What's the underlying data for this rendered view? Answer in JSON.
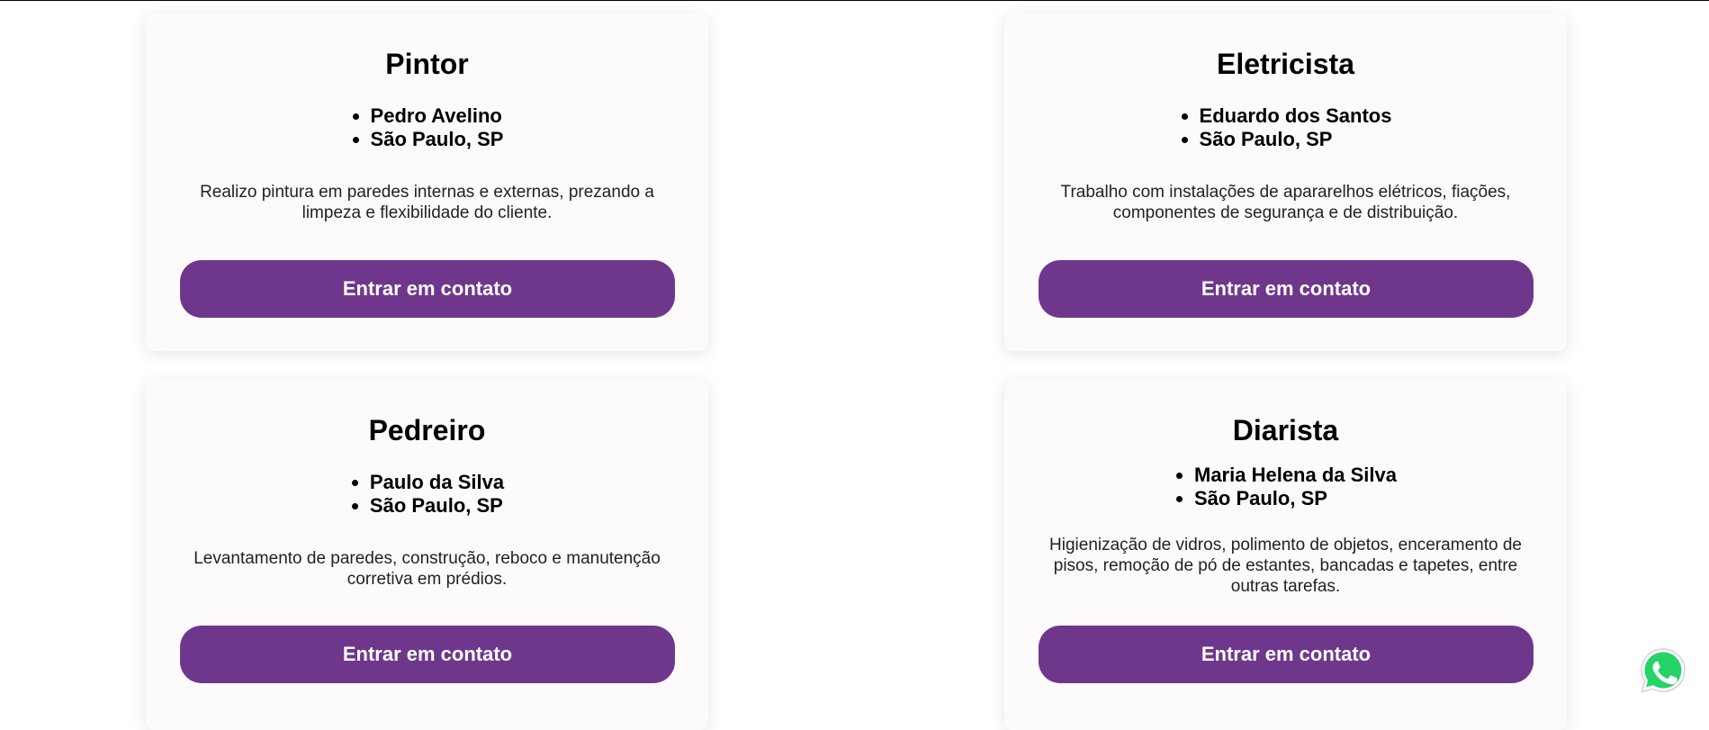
{
  "cards": [
    {
      "title": "Pintor",
      "name": "Pedro Avelino",
      "location": "São Paulo, SP",
      "description": "Realizo pintura em paredes internas e externas, prezando a limpeza e flexibilidade do cliente.",
      "button_label": "Entrar em contato"
    },
    {
      "title": "Eletricista",
      "name": "Eduardo dos Santos",
      "location": "São Paulo, SP",
      "description": "Trabalho com instalações de apararelhos elétricos, fiações, componentes de segurança e de distribuição.",
      "button_label": "Entrar em contato"
    },
    {
      "title": "Pedreiro",
      "name": "Paulo da Silva",
      "location": "São Paulo, SP",
      "description": "Levantamento de paredes, construção, reboco e manutenção corretiva em prédios.",
      "button_label": "Entrar em contato"
    },
    {
      "title": "Diarista",
      "name": "Maria Helena da Silva",
      "location": "São Paulo, SP",
      "description": "Higienização de vidros, polimento de objetos, enceramento de pisos, remoção de pó de estantes, bancadas e tapetes, entre outras tarefas.",
      "button_label": "Entrar em contato"
    }
  ],
  "floating": {
    "icon": "whatsapp-icon"
  },
  "colors": {
    "accent": "#6f378b",
    "card_bg": "#fdfafc",
    "whatsapp": "#25d366"
  }
}
